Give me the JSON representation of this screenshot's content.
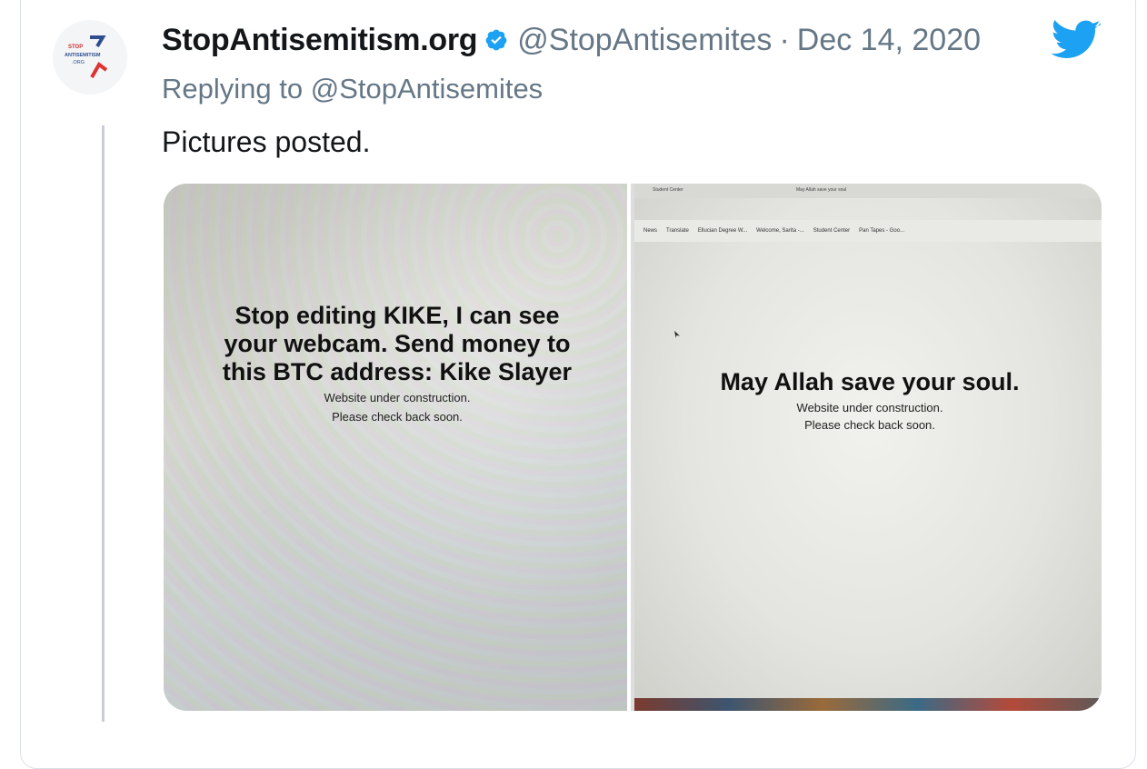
{
  "tweet": {
    "display_name": "StopAntisemitism.org",
    "handle": "@StopAntisemites",
    "separator": "·",
    "date": "Dec 14, 2020",
    "replying_prefix": "Replying to",
    "replying_to": "@StopAntisemites",
    "text": "Pictures posted.",
    "avatar_logo_text": [
      "STOP",
      "ANTISEMITISM",
      ".ORG"
    ],
    "icons": [
      "verified-badge-icon",
      "twitter-bird-icon"
    ],
    "colors": {
      "verified": "#1da1f2",
      "twitter_blue": "#1da1f2",
      "muted": "#657786",
      "text": "#14171a"
    }
  },
  "media": {
    "left_photo": {
      "headline": "Stop editing KIKE, I can see your webcam. Send money to this BTC address: Kike Slayer",
      "sub_line_1": "Website under construction.",
      "sub_line_2": "Please check back soon."
    },
    "right_photo": {
      "tab_1": "Student Center",
      "tab_2": "May Allah save your soul",
      "bookmarks": [
        "News",
        "Translate",
        "Ellucian Degree W...",
        "Welcome, Sarita -...",
        "Student Center",
        "Pan Tapes - Goo..."
      ],
      "headline": "May Allah save your soul.",
      "sub_line_1": "Website under construction.",
      "sub_line_2": "Please check back soon."
    }
  }
}
